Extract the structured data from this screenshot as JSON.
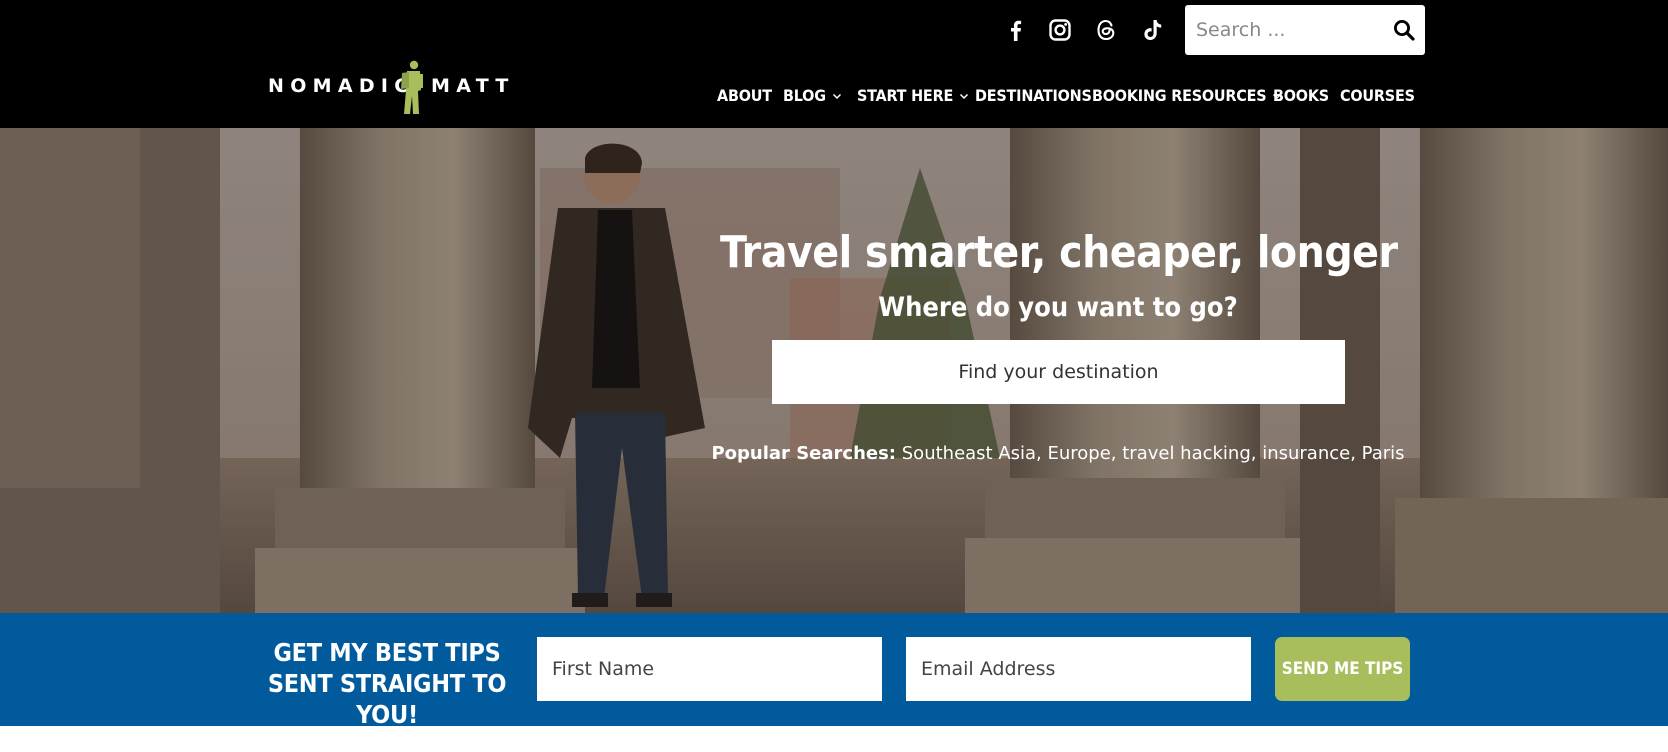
{
  "brand": {
    "name_left": "NOMADIC",
    "name_right": "MATT",
    "logo_icon": "hiker-with-backpack-icon",
    "accent_green": "#a8bd5b",
    "brand_blue": "#005a9c",
    "header_black": "#000000"
  },
  "social": [
    {
      "name": "facebook",
      "icon": "facebook-icon"
    },
    {
      "name": "instagram",
      "icon": "instagram-icon"
    },
    {
      "name": "threads",
      "icon": "threads-icon"
    },
    {
      "name": "tiktok",
      "icon": "tiktok-icon"
    }
  ],
  "search": {
    "placeholder": "Search ...",
    "icon": "search-icon"
  },
  "nav": {
    "items": [
      {
        "label": "ABOUT",
        "has_dropdown": false
      },
      {
        "label": "BLOG",
        "has_dropdown": true
      },
      {
        "label": "START HERE",
        "has_dropdown": true
      },
      {
        "label": "DESTINATIONS",
        "has_dropdown": false
      },
      {
        "label": "BOOKING RESOURCES",
        "has_dropdown": true
      },
      {
        "label": "BOOKS",
        "has_dropdown": false
      },
      {
        "label": "COURSES",
        "has_dropdown": false
      }
    ]
  },
  "hero": {
    "title": "Travel smarter, cheaper, longer",
    "subtitle": "Where do you want to go?",
    "destination_placeholder": "Find your destination",
    "popular_label": "Popular Searches:",
    "popular_terms": "Southeast Asia, Europe, travel hacking, insurance, Paris"
  },
  "optin": {
    "heading": "GET MY BEST TIPS SENT STRAIGHT TO YOU!",
    "first_name_placeholder": "First Name",
    "email_placeholder": "Email Address",
    "button_label": "SEND ME TIPS"
  }
}
